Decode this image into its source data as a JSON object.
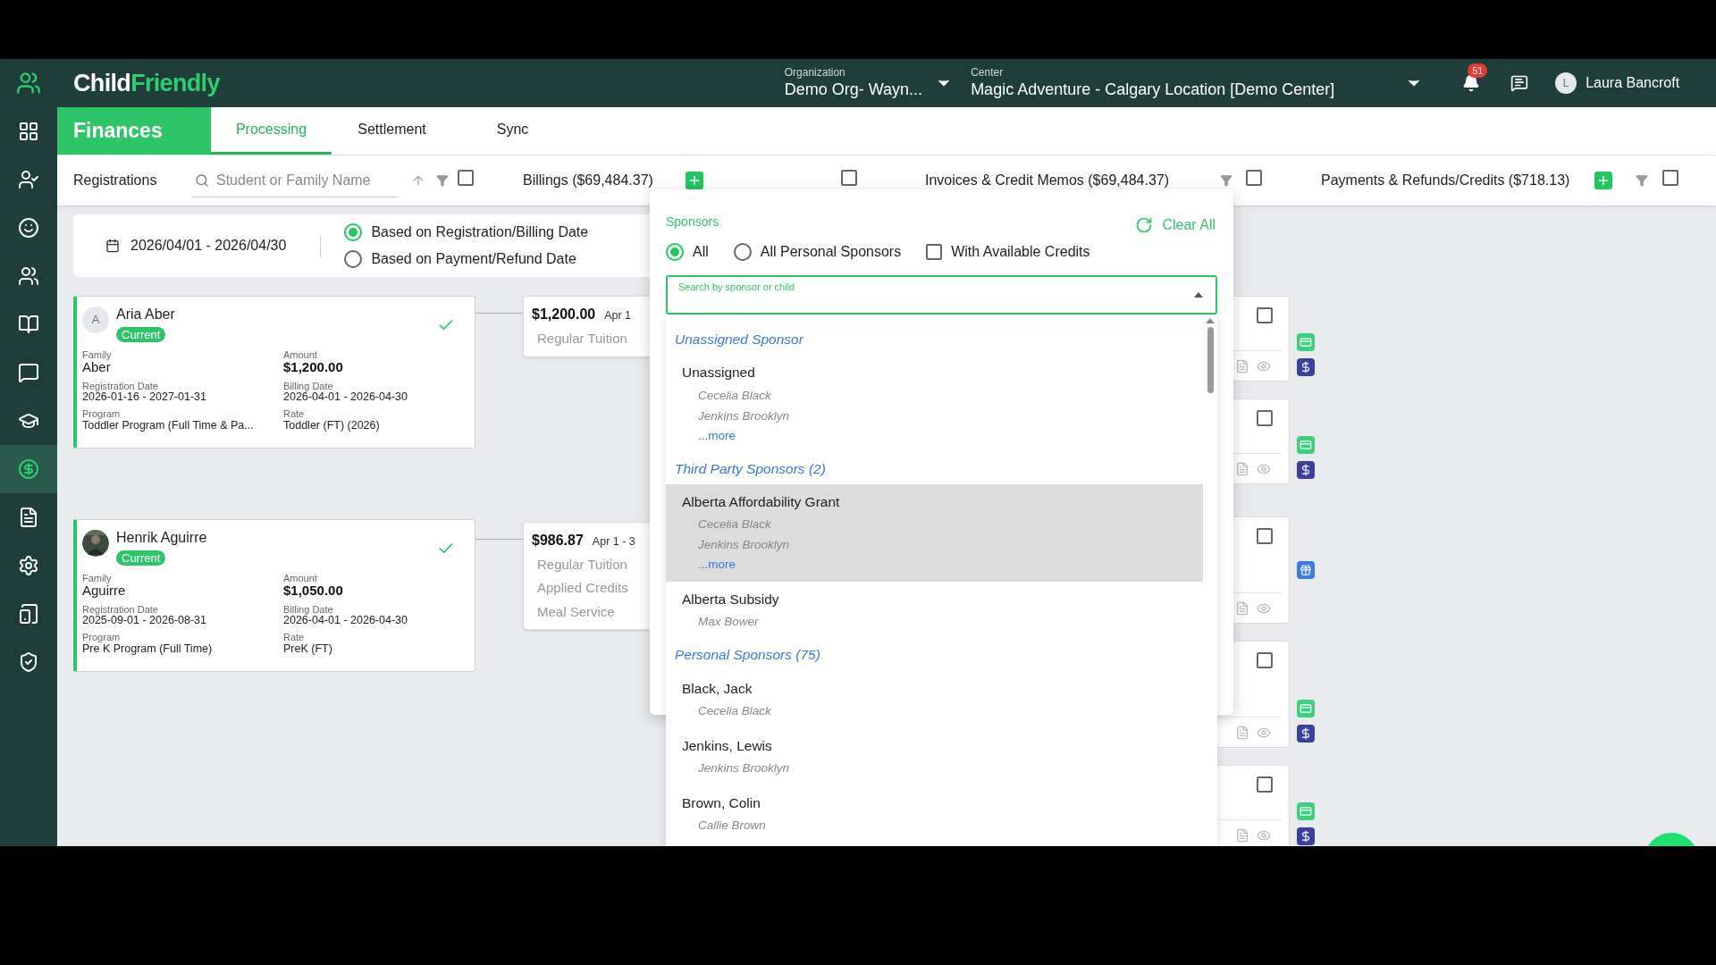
{
  "sidebar": {
    "items": [
      {
        "selected": false
      },
      {
        "selected": false
      },
      {
        "selected": false
      },
      {
        "selected": false
      },
      {
        "selected": false
      },
      {
        "selected": false
      },
      {
        "selected": false
      },
      {
        "selected": true
      },
      {
        "selected": false
      },
      {
        "selected": false
      },
      {
        "selected": false
      },
      {
        "selected": false
      }
    ]
  },
  "header": {
    "logo": {
      "first": "Child",
      "second": "Friendly"
    },
    "organization": {
      "label": "Organization",
      "value": "Demo Org- Wayn..."
    },
    "center": {
      "label": "Center",
      "value": "Magic Adventure - Calgary Location [Demo Center]"
    },
    "notifications": "51",
    "user": {
      "initial": "L",
      "name": "Laura Bancroft"
    }
  },
  "module": {
    "title": "Finances"
  },
  "tabs": [
    {
      "label": "Processing",
      "selected": true
    },
    {
      "label": "Settlement",
      "selected": false
    },
    {
      "label": "Sync",
      "selected": false
    }
  ],
  "filter_bar": {
    "registrations": {
      "title": "Registrations",
      "search_placeholder": "Student or Family Name",
      "checked": false
    },
    "billings": {
      "title": "Billings ($69,484.37)",
      "checked": false
    },
    "invoices": {
      "title": "Invoices & Credit Memos ($69,484.37)",
      "checked": false
    },
    "payments": {
      "title": "Payments & Refunds/Credits ($718.13)",
      "checked": false
    }
  },
  "date_filter": {
    "range": "2026/04/01 - 2026/04/30",
    "options": [
      {
        "label": "Based on Registration/Billing Date",
        "selected": true
      },
      {
        "label": "Based on Payment/Refund Date",
        "selected": false
      }
    ]
  },
  "registrations": [
    {
      "name": "Aria Aber",
      "avatar": {
        "kind": "initial",
        "initial": "A"
      },
      "status": "Current",
      "verified": true,
      "fields": [
        {
          "label": "Family",
          "value": "Aber"
        },
        {
          "label": "Amount",
          "value": "$1,200.00"
        },
        {
          "label": "Registration Date",
          "value": "2026-01-16 - 2027-01-31"
        },
        {
          "label": "Billing Date",
          "value": "2026-04-01 - 2026-04-30"
        },
        {
          "label": "Program",
          "value": "Toddler Program (Full Time & Pa..."
        },
        {
          "label": "Rate",
          "value": "Toddler (FT) (2026)"
        }
      ]
    },
    {
      "name": "Henrik Aguirre",
      "status": "Current",
      "verified": true,
      "fields": [
        {
          "label": "Family",
          "value": "Aguirre"
        },
        {
          "label": "Amount",
          "value": "$1,050.00"
        },
        {
          "label": "Registration Date",
          "value": "2025-09-01 - 2026-08-31"
        },
        {
          "label": "Billing Date",
          "value": "2026-04-01 - 2026-04-30"
        },
        {
          "label": "Program",
          "value": "Pre K Program (Full Time)"
        },
        {
          "label": "Rate",
          "value": "PreK (FT)"
        }
      ]
    }
  ],
  "billings": [
    {
      "amount": "$1,200.00",
      "date": "Apr 1",
      "lines": [
        "Regular Tuition"
      ]
    },
    {
      "amount": "$986.87",
      "date": "Apr 1 - 3",
      "lines": [
        "Regular Tuition",
        "Applied Credits",
        "Meal Service"
      ]
    }
  ],
  "payment_cards": [
    {
      "checked": false,
      "badges": [
        {
          "kind": "card"
        },
        {
          "kind": "dollar"
        }
      ]
    },
    {
      "checked": false,
      "badges": [
        {
          "kind": "card"
        },
        {
          "kind": "dollar"
        }
      ]
    },
    {
      "checked": false,
      "badges": [
        {
          "kind": "gift"
        }
      ]
    },
    {
      "checked": false,
      "badges": [
        {
          "kind": "card"
        },
        {
          "kind": "dollar"
        }
      ]
    },
    {
      "checked": false,
      "badges": [
        {
          "kind": "card"
        },
        {
          "kind": "dollar"
        }
      ]
    }
  ],
  "sponsor_popover": {
    "title": "Sponsors",
    "clear_label": "Clear All",
    "options": [
      {
        "kind": "radio",
        "label": "All",
        "selected": true
      },
      {
        "kind": "radio",
        "label": "All Personal Sponsors",
        "selected": false
      },
      {
        "kind": "checkbox",
        "label": "With Available Credits",
        "checked": false
      }
    ],
    "search": {
      "label": "Search by sponsor or child"
    },
    "groups": [
      {
        "title": "Unassigned Sponsor",
        "items": [
          {
            "name": "Unassigned",
            "students": [
              "Cecelia Black",
              "Jenkins Brooklyn"
            ],
            "more": "...more",
            "highlighted": false
          }
        ]
      },
      {
        "title": "Third Party Sponsors (2)",
        "items": [
          {
            "name": "Alberta Affordability Grant",
            "students": [
              "Cecelia Black",
              "Jenkins Brooklyn"
            ],
            "more": "...more",
            "highlighted": true
          },
          {
            "name": "Alberta Subsidy",
            "students": [
              "Max Bower"
            ],
            "highlighted": false
          }
        ]
      },
      {
        "title": "Personal Sponsors (75)",
        "items": [
          {
            "name": "Black, Jack",
            "students": [
              "Cecelia Black"
            ],
            "highlighted": false
          },
          {
            "name": "Jenkins, Lewis",
            "students": [
              "Jenkins Brooklyn"
            ],
            "highlighted": false
          },
          {
            "name": "Brown, Colin",
            "students": [
              "Callie Brown"
            ],
            "highlighted": false
          }
        ]
      }
    ]
  }
}
